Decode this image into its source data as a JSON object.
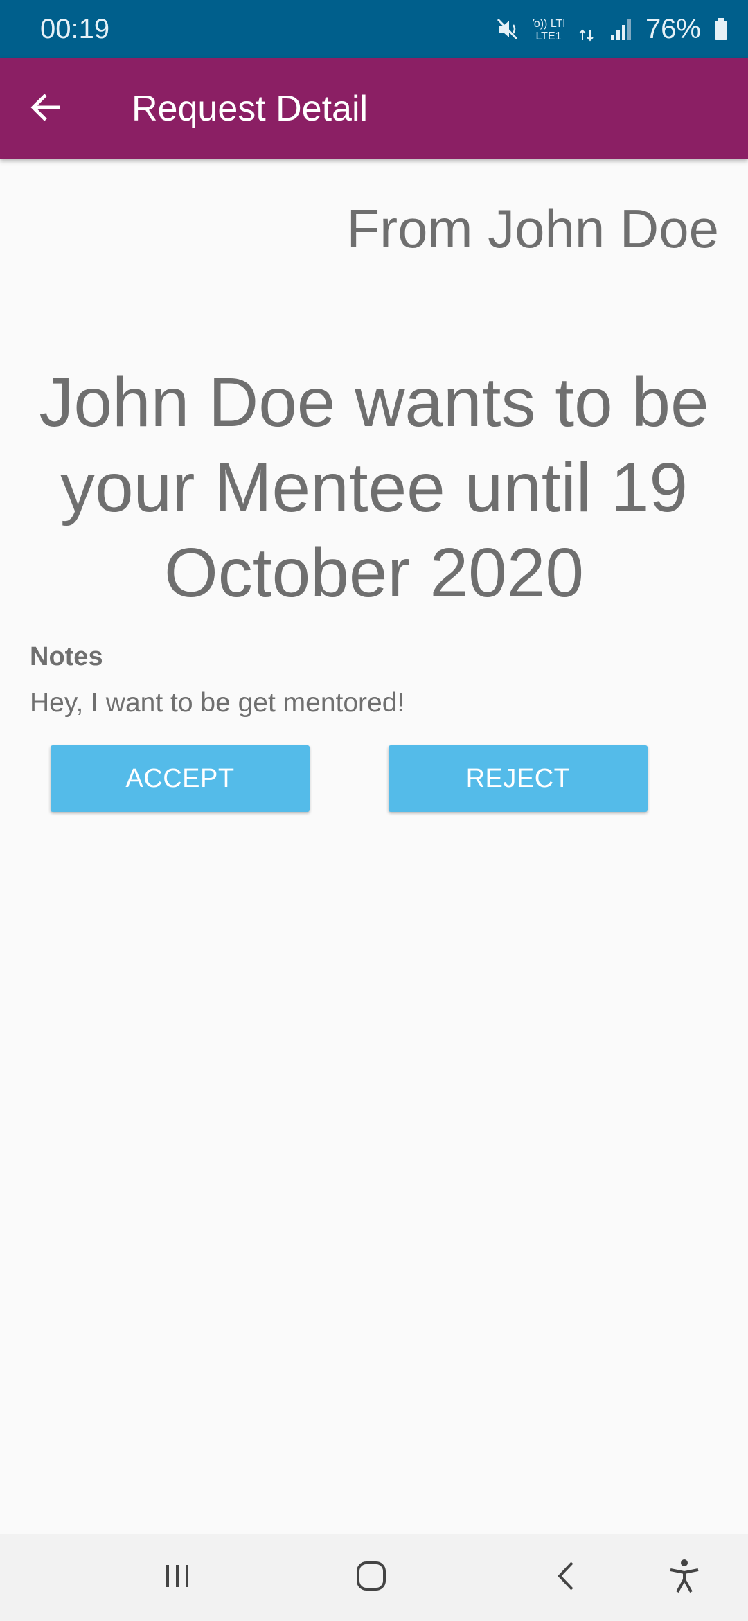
{
  "status_bar": {
    "time": "00:19",
    "network_top": "Vo)) LTE",
    "network_bottom": "LTE1",
    "battery_percent": "76%",
    "icons": [
      "mute-vibrate-icon",
      "volte-icon",
      "lte-data-icon",
      "signal-icon",
      "battery-icon"
    ]
  },
  "app_bar": {
    "title": "Request Detail",
    "back_icon": "arrow-left-icon"
  },
  "request": {
    "from_line": "From John Doe",
    "message": "John Doe wants to be your Mentee until 19 October 2020",
    "notes_heading": "Notes",
    "notes_body": "Hey, I want to be get mentored!"
  },
  "actions": {
    "accept_label": "ACCEPT",
    "reject_label": "REJECT"
  },
  "nav_bar": {
    "icons": [
      "recents-icon",
      "home-icon",
      "back-icon",
      "accessibility-icon"
    ]
  },
  "colors": {
    "status_bar": "#005f8c",
    "app_bar": "#8b1f64",
    "button": "#54bbe9",
    "text": "#6f6f6f",
    "background": "#fafafa"
  }
}
